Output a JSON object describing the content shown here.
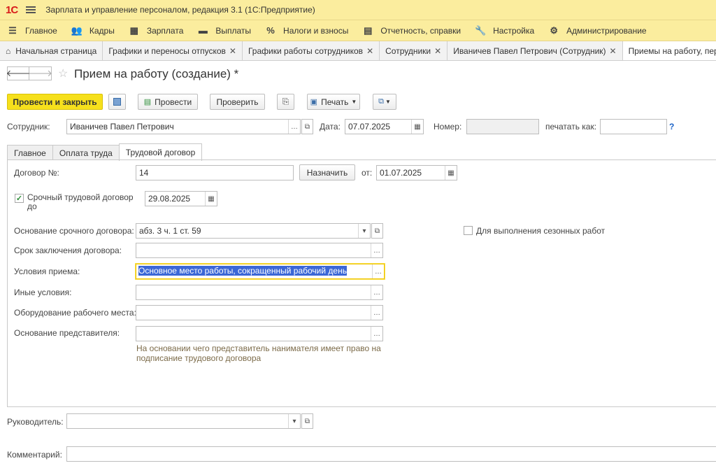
{
  "app": {
    "logo": "1С",
    "title": "Зарплата и управление персоналом, редакция 3.1  (1С:Предприятие)"
  },
  "menu": [
    {
      "icon": "hamburger-icon",
      "label": "Главное"
    },
    {
      "icon": "people-icon",
      "label": "Кадры"
    },
    {
      "icon": "calculator-icon",
      "label": "Зарплата"
    },
    {
      "icon": "payment-icon",
      "label": "Выплаты"
    },
    {
      "icon": "percent-icon",
      "label": "Налоги и взносы"
    },
    {
      "icon": "report-icon",
      "label": "Отчетность, справки"
    },
    {
      "icon": "wrench-icon",
      "label": "Настройка"
    },
    {
      "icon": "gear-icon",
      "label": "Администрирование"
    }
  ],
  "open_tabs": [
    {
      "label": "Начальная страница",
      "closable": false
    },
    {
      "label": "Графики и переносы отпусков",
      "closable": true
    },
    {
      "label": "Графики работы сотрудников",
      "closable": true
    },
    {
      "label": "Сотрудники",
      "closable": true
    },
    {
      "label": "Иваничев Павел Петрович (Сотрудник)",
      "closable": true
    },
    {
      "label": "Приемы на работу, переводы",
      "closable": false
    }
  ],
  "form": {
    "title": "Прием на работу (создание) *",
    "toolbar": {
      "post_close": "Провести и закрыть",
      "post": "Провести",
      "check": "Проверить",
      "print": "Печать"
    },
    "header": {
      "employee_label": "Сотрудник:",
      "employee_value": "Иваничев Павел Петрович",
      "date_label": "Дата:",
      "date_value": "07.07.2025",
      "number_label": "Номер:",
      "number_value": "",
      "print_as_label": "печатать как:",
      "print_as_value": "",
      "help": "?"
    },
    "tabs": [
      "Главное",
      "Оплата труда",
      "Трудовой договор"
    ],
    "active_tab": "Трудовой договор",
    "contract": {
      "number_label": "Договор №:",
      "number_value": "14",
      "assign_button": "Назначить",
      "from_label": "от:",
      "from_value": "01.07.2025",
      "fixed_term_label": "Срочный трудовой договор до",
      "fixed_term_checked": true,
      "fixed_term_date": "29.08.2025",
      "basis_label": "Основание срочного договора:",
      "basis_value": "абз. 3 ч. 1 ст. 59",
      "seasonal_label": "Для выполнения сезонных работ",
      "seasonal_checked": false,
      "term_label": "Срок заключения договора:",
      "term_value": "",
      "conditions_label": "Условия приема:",
      "conditions_value": "Основное место работы, сокращенный рабочий день",
      "other_label": "Иные условия:",
      "other_value": "",
      "equipment_label": "Оборудование рабочего места:",
      "equipment_value": "",
      "rep_basis_label": "Основание представителя:",
      "rep_basis_value": "",
      "rep_basis_hint": "На основании чего представитель нанимателя имеет право на подписание трудового договора"
    },
    "manager_label": "Руководитель:",
    "manager_value": "",
    "comment_label": "Комментарий:",
    "comment_value": ""
  },
  "colors": {
    "topbar": "#fbed9e",
    "primary_button": "#f6e01c",
    "selection": "#3b67d6",
    "help": "#1b62c7",
    "hint": "#7b6a48"
  }
}
